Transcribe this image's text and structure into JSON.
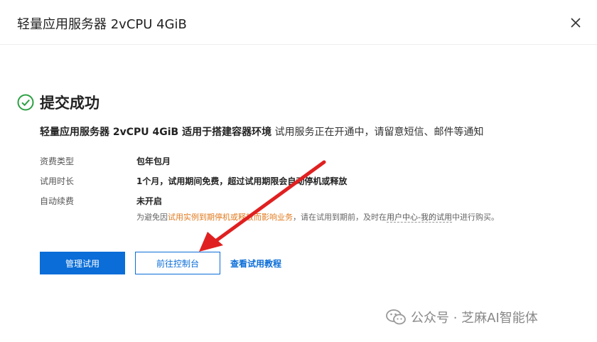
{
  "dialog": {
    "title": "轻量应用服务器 2vCPU 4GiB",
    "close_icon": "close-icon"
  },
  "status": {
    "icon": "check-circle-icon",
    "text": "提交成功",
    "color": "#2ea043"
  },
  "description": {
    "product": "轻量应用服务器 2vCPU 4GiB 适用于搭建容器环境",
    "message": " 试用服务正在开通中，请留意短信、邮件等通知"
  },
  "details": [
    {
      "label": "资费类型",
      "value": "包年包月"
    },
    {
      "label": "试用时长",
      "value": "1个月，试用期间免费，超过试用期限会自动停机或释放"
    },
    {
      "label": "自动续费",
      "value": "未开启"
    }
  ],
  "note": {
    "prefix": "为避免因",
    "warning": "试用实例到期停机或释放而影响业务",
    "middle": "，请在试用到期前，及时在",
    "link": "用户中心-我的试用",
    "suffix": "中进行购买。"
  },
  "actions": {
    "manage_label": "管理试用",
    "console_label": "前往控制台",
    "tutorial_label": "查看试用教程"
  },
  "colors": {
    "primary": "#0a6dd8",
    "warning": "#e07a1f",
    "annotation_arrow": "#e02020"
  },
  "watermark": {
    "icon": "wechat-icon",
    "text": "公众号 · 芝麻AI智能体"
  }
}
